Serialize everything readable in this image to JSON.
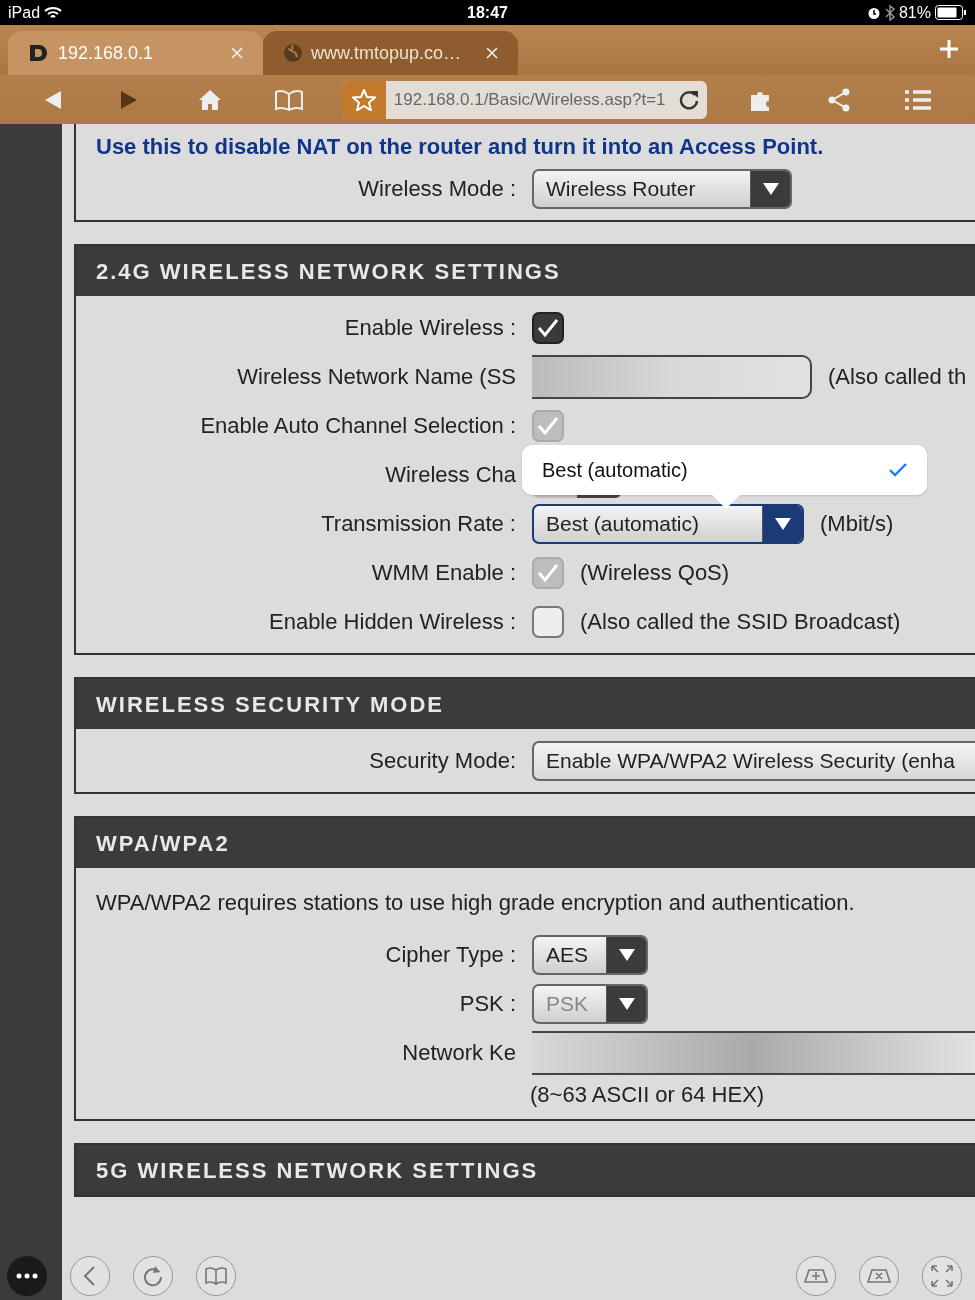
{
  "status_bar": {
    "carrier": "iPad",
    "time": "18:47",
    "battery": "81%"
  },
  "browser": {
    "tabs": [
      {
        "title": "192.168.0.1",
        "selected": true,
        "kind": "dlink"
      },
      {
        "title": "www.tmtopup.co…",
        "selected": false,
        "kind": "globe"
      }
    ],
    "address": "192.168.0.1/Basic/Wireless.asp?t=1"
  },
  "sections": [
    {
      "intro": "Use this to disable NAT on the router and turn it into an Access Point.",
      "fields": [
        {
          "kind": "select",
          "label": "Wireless Mode :",
          "value": "Wireless Router"
        }
      ]
    },
    {
      "heading": "2.4G WIRELESS NETWORK SETTINGS",
      "fields": [
        {
          "kind": "checkbox",
          "label": "Enable Wireless :",
          "checked": true,
          "disabled": false
        },
        {
          "kind": "masked",
          "label": "Wireless Network Name (SS",
          "note": "(Also called th"
        },
        {
          "kind": "checkbox",
          "label": "Enable Auto Channel Selection :",
          "checked": true,
          "disabled": true
        },
        {
          "kind": "covered",
          "label": "Wireless Cha"
        },
        {
          "kind": "select",
          "label": "Transmission Rate :",
          "value": "Best (automatic)",
          "note": "(Mbit/s)",
          "focused": true
        },
        {
          "kind": "checkbox",
          "label": "WMM Enable :",
          "checked": true,
          "disabled": true,
          "note": "(Wireless QoS)"
        },
        {
          "kind": "checkbox",
          "label": "Enable Hidden Wireless :",
          "checked": false,
          "disabled": false,
          "note": "(Also called the SSID Broadcast)"
        }
      ]
    },
    {
      "heading": "WIRELESS SECURITY MODE",
      "fields": [
        {
          "kind": "wide",
          "label": "Security Mode:",
          "value": "Enable WPA/WPA2 Wireless Security (enha"
        }
      ]
    },
    {
      "heading": "WPA/WPA2",
      "intro": "WPA/WPA2 requires stations to use high grade encryption and authentication.",
      "fields": [
        {
          "kind": "select",
          "label": "Cipher Type :",
          "value": "AES"
        },
        {
          "kind": "select",
          "label": "PSK :",
          "value": "PSK",
          "disabled": true
        },
        {
          "kind": "masked_long",
          "label": "Network Ke",
          "hint": "(8~63 ASCII or 64 HEX)"
        }
      ]
    },
    {
      "heading": "5G WIRELESS NETWORK SETTINGS"
    }
  ],
  "popover": {
    "options": [
      {
        "label": "Best (automatic)",
        "selected": true
      }
    ]
  }
}
